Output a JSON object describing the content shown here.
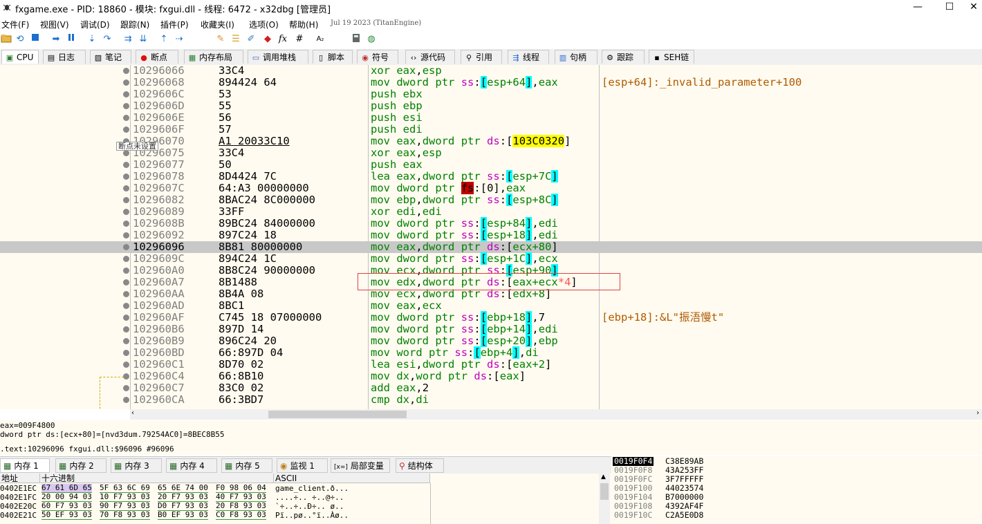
{
  "window": {
    "title": "fxgame.exe - PID: 18860 - 模块: fxgui.dll - 线程: 6472 - x32dbg [管理员]",
    "minimize": "—",
    "maximize": "☐",
    "close": "✕"
  },
  "menu": {
    "items": [
      "文件(F)",
      "视图(V)",
      "调试(D)",
      "跟踪(N)",
      "插件(P)",
      "收藏夹(I)",
      "选项(O)",
      "帮助(H)"
    ],
    "build_date": "Jul 19 2023 (TitanEngine)"
  },
  "toolbar": {
    "icons": [
      "open-icon",
      "restart-icon",
      "stop-icon",
      "run-icon",
      "pause-icon",
      "step-into-icon",
      "step-over-icon",
      "trace-into-icon",
      "trace-over-icon",
      "execute-till-return-icon",
      "run-to-user-code-icon",
      "patch-icon",
      "comment-icon",
      "label-icon",
      "bookmark-icon",
      "function-icon",
      "hash-icon",
      "font-icon",
      "calculator-icon",
      "globe-icon"
    ],
    "font_glyph": "A₂",
    "hash_glyph": "#",
    "fx_glyph": "fx"
  },
  "tabs": [
    {
      "label": "CPU",
      "icon": "cpu-icon"
    },
    {
      "label": "日志",
      "icon": "log-icon"
    },
    {
      "label": "笔记",
      "icon": "notes-icon"
    },
    {
      "label": "断点",
      "icon": "breakpoint-icon"
    },
    {
      "label": "内存布局",
      "icon": "memory-map-icon"
    },
    {
      "label": "调用堆栈",
      "icon": "call-stack-icon"
    },
    {
      "label": "脚本",
      "icon": "script-icon"
    },
    {
      "label": "符号",
      "icon": "symbols-icon"
    },
    {
      "label": "源代码",
      "icon": "source-icon"
    },
    {
      "label": "引用",
      "icon": "references-icon"
    },
    {
      "label": "线程",
      "icon": "threads-icon"
    },
    {
      "label": "句柄",
      "icon": "handles-icon"
    },
    {
      "label": "跟踪",
      "icon": "trace-icon"
    },
    {
      "label": "SEH链",
      "icon": "seh-icon"
    }
  ],
  "disasm": {
    "tooltip": "断点未设置",
    "rows": [
      {
        "addr": "10296066",
        "bytes": "33C4",
        "dis": "xor eax,esp",
        "cmt": ""
      },
      {
        "addr": "10296068",
        "bytes": "894424 64",
        "dis": "mov dword ptr ss:[esp+64],eax",
        "cmt": "[esp+64]:_invalid_parameter+100"
      },
      {
        "addr": "1029606C",
        "bytes": "53",
        "dis": "push ebx",
        "cmt": ""
      },
      {
        "addr": "1029606D",
        "bytes": "55",
        "dis": "push ebp",
        "cmt": ""
      },
      {
        "addr": "1029606E",
        "bytes": "56",
        "dis": "push esi",
        "cmt": ""
      },
      {
        "addr": "1029606F",
        "bytes": "57",
        "dis": "push edi",
        "cmt": ""
      },
      {
        "addr": "10296070",
        "bytes": "A1 20033C10",
        "dis": "mov eax,dword ptr ds:[103C0320]",
        "cmt": ""
      },
      {
        "addr": "10296075",
        "bytes": "33C4",
        "dis": "xor eax,esp",
        "cmt": ""
      },
      {
        "addr": "10296077",
        "bytes": "50",
        "dis": "push eax",
        "cmt": ""
      },
      {
        "addr": "10296078",
        "bytes": "8D4424 7C",
        "dis": "lea eax,dword ptr ss:[esp+7C]",
        "cmt": ""
      },
      {
        "addr": "1029607C",
        "bytes": "64:A3 00000000",
        "dis": "mov dword ptr fs:[0],eax",
        "cmt": ""
      },
      {
        "addr": "10296082",
        "bytes": "8BAC24 8C000000",
        "dis": "mov ebp,dword ptr ss:[esp+8C]",
        "cmt": ""
      },
      {
        "addr": "10296089",
        "bytes": "33FF",
        "dis": "xor edi,edi",
        "cmt": ""
      },
      {
        "addr": "1029608B",
        "bytes": "89BC24 84000000",
        "dis": "mov dword ptr ss:[esp+84],edi",
        "cmt": ""
      },
      {
        "addr": "10296092",
        "bytes": "897C24 18",
        "dis": "mov dword ptr ss:[esp+18],edi",
        "cmt": ""
      },
      {
        "addr": "10296096",
        "bytes": "8B81 80000000",
        "dis": "mov eax,dword ptr ds:[ecx+80]",
        "cmt": ""
      },
      {
        "addr": "1029609C",
        "bytes": "894C24 1C",
        "dis": "mov dword ptr ss:[esp+1C],ecx",
        "cmt": ""
      },
      {
        "addr": "102960A0",
        "bytes": "8B8C24 90000000",
        "dis": "mov ecx,dword ptr ss:[esp+90]",
        "cmt": ""
      },
      {
        "addr": "102960A7",
        "bytes": "8B1488",
        "dis": "mov edx,dword ptr ds:[eax+ecx*4]",
        "cmt": ""
      },
      {
        "addr": "102960AA",
        "bytes": "8B4A 08",
        "dis": "mov ecx,dword ptr ds:[edx+8]",
        "cmt": ""
      },
      {
        "addr": "102960AD",
        "bytes": "8BC1",
        "dis": "mov eax,ecx",
        "cmt": ""
      },
      {
        "addr": "102960AF",
        "bytes": "C745 18 07000000",
        "dis": "mov dword ptr ss:[ebp+18],7",
        "cmt": "[ebp+18]:&L\"振浯慢t\""
      },
      {
        "addr": "102960B6",
        "bytes": "897D 14",
        "dis": "mov dword ptr ss:[ebp+14],edi",
        "cmt": ""
      },
      {
        "addr": "102960B9",
        "bytes": "896C24 20",
        "dis": "mov dword ptr ss:[esp+20],ebp",
        "cmt": ""
      },
      {
        "addr": "102960BD",
        "bytes": "66:897D 04",
        "dis": "mov word ptr ss:[ebp+4],di",
        "cmt": ""
      },
      {
        "addr": "102960C1",
        "bytes": "8D70 02",
        "dis": "lea esi,dword ptr ds:[eax+2]",
        "cmt": ""
      },
      {
        "addr": "102960C4",
        "bytes": "66:8B10",
        "dis": "mov dx,word ptr ds:[eax]",
        "cmt": ""
      },
      {
        "addr": "102960C7",
        "bytes": "83C0 02",
        "dis": "add eax,2",
        "cmt": ""
      },
      {
        "addr": "102960CA",
        "bytes": "66:3BD7",
        "dis": "cmp dx,di",
        "cmt": ""
      }
    ]
  },
  "info": {
    "line1": "eax=009F4800",
    "line2": "dword ptr ds:[ecx+80]=[nvd3dum.79254AC0]=8BEC8B55",
    "line3": ".text:10296096 fxgui.dll:$96096 #96096"
  },
  "bottom_tabs": [
    {
      "label": "内存 1",
      "icon": "memory-icon"
    },
    {
      "label": "内存 2",
      "icon": "memory-icon"
    },
    {
      "label": "内存 3",
      "icon": "memory-icon"
    },
    {
      "label": "内存 4",
      "icon": "memory-icon"
    },
    {
      "label": "内存 5",
      "icon": "memory-icon"
    },
    {
      "label": "监视 1",
      "icon": "watch-icon"
    },
    {
      "label": "局部变量",
      "icon": "locals-icon"
    },
    {
      "label": "结构体",
      "icon": "struct-icon"
    }
  ],
  "dump": {
    "headers": {
      "addr": "地址",
      "hex": "十六进制",
      "ascii": "ASCII"
    },
    "rows": [
      {
        "addr": "0402E1EC",
        "hex": [
          "67 61 6D 65",
          "5F 63 6C 69",
          "65 6E 74 00",
          "F0 98 06 04"
        ],
        "ascii": "game_client.ð..."
      },
      {
        "addr": "0402E1FC",
        "hex": [
          "20 00 94 03",
          "10 F7 93 03",
          "20 F7 93 03",
          "40 F7 93 03"
        ],
        "ascii": " ....÷..  ÷..@÷.."
      },
      {
        "addr": "0402E20C",
        "hex": [
          "60 F7 93 03",
          "90 F7 93 03",
          "D0 F7 93 03",
          "20 F8 93 03"
        ],
        "ascii": "`÷..÷..Ð÷.. ø.."
      },
      {
        "addr": "0402E21C",
        "hex": [
          "50 EF 93 03",
          "70 F8 93 03",
          "B0 EF 93 03",
          "C0 F8 93 03"
        ],
        "ascii": "Pï..pø..°ï..Àø.."
      }
    ]
  },
  "stack": {
    "rows": [
      {
        "addr": "0019F0F4",
        "val": "C38E89AB"
      },
      {
        "addr": "0019F0F8",
        "val": "43A253FF"
      },
      {
        "addr": "0019F0FC",
        "val": "3F7FFFFF"
      },
      {
        "addr": "0019F100",
        "val": "44023574"
      },
      {
        "addr": "0019F104",
        "val": "B7000000"
      },
      {
        "addr": "0019F108",
        "val": "4392AF4F"
      },
      {
        "addr": "0019F10C",
        "val": "C2A5E0D8"
      }
    ]
  }
}
